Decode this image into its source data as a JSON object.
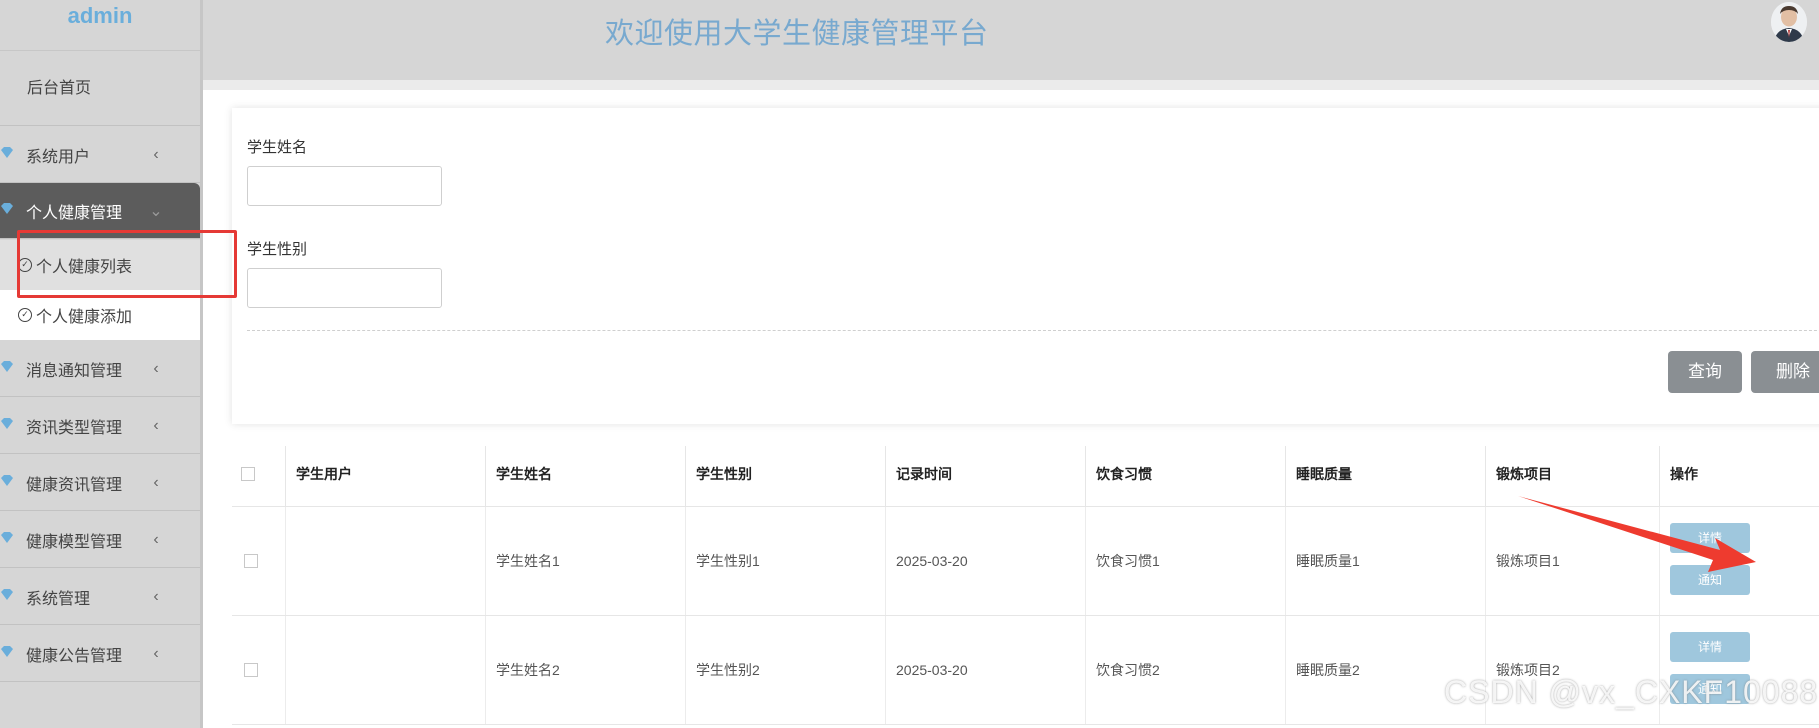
{
  "sidebar": {
    "brand": "admin",
    "home": "后台首页",
    "items": [
      {
        "label": "系统用户"
      },
      {
        "label": "个人健康管理"
      },
      {
        "label": "消息通知管理"
      },
      {
        "label": "资讯类型管理"
      },
      {
        "label": "健康资讯管理"
      },
      {
        "label": "健康模型管理"
      },
      {
        "label": "系统管理"
      },
      {
        "label": "健康公告管理"
      }
    ],
    "sub_items": [
      {
        "label": "个人健康列表"
      },
      {
        "label": "个人健康添加"
      }
    ],
    "icon": "heart-gem-icon"
  },
  "header": {
    "title": "欢迎使用大学生健康管理平台",
    "avatar_icon": "user-avatar-icon"
  },
  "search": {
    "name_label": "学生姓名",
    "gender_label": "学生性别",
    "name_value": "",
    "gender_value": "",
    "query_button": "查询",
    "delete_button": "删除"
  },
  "table": {
    "columns": [
      "学生用户",
      "学生姓名",
      "学生性别",
      "记录时间",
      "饮食习惯",
      "睡眠质量",
      "锻炼项目",
      "操作"
    ],
    "rows": [
      {
        "user": "",
        "name": "学生姓名1",
        "gender": "学生性别1",
        "time": "2025-03-20",
        "diet": "饮食习惯1",
        "sleep": "睡眠质量1",
        "exercise": "锻炼项目1"
      },
      {
        "user": "",
        "name": "学生姓名2",
        "gender": "学生性别2",
        "time": "2025-03-20",
        "diet": "饮食习惯2",
        "sleep": "睡眠质量2",
        "exercise": "锻炼项目2"
      }
    ],
    "detail_label": "详情",
    "notify_label": "通知"
  },
  "watermark": "CSDN @vx_CXKF10088",
  "colors": {
    "accent_blue": "#78a9cf",
    "action_button": "#9fc7dd",
    "highlight_box": "#e53935",
    "arrow": "#ee3b2f",
    "active_menu": "#5c5c5c"
  }
}
